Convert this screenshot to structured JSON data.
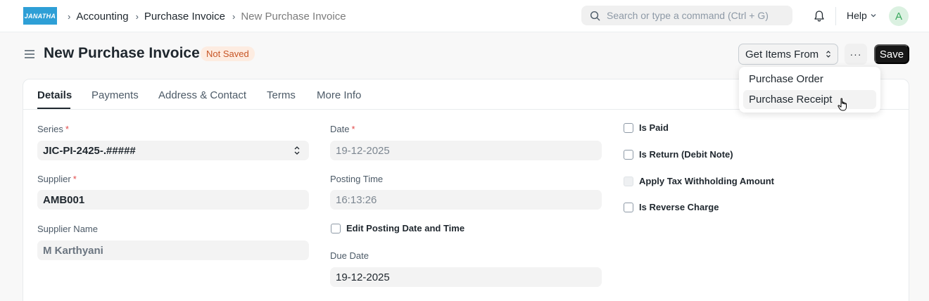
{
  "navbar": {
    "logo_text": "JANATHA",
    "breadcrumbs": [
      "Accounting",
      "Purchase Invoice",
      "New Purchase Invoice"
    ],
    "search_placeholder": "Search or type a command (Ctrl + G)",
    "help_label": "Help",
    "avatar_letter": "A"
  },
  "page": {
    "title": "New Purchase Invoice",
    "status_badge": "Not Saved",
    "get_items_label": "Get Items From",
    "more_label": "···",
    "save_label": "Save"
  },
  "dropdown": {
    "items": [
      "Purchase Order",
      "Purchase Receipt"
    ]
  },
  "tabs": [
    "Details",
    "Payments",
    "Address & Contact",
    "Terms",
    "More Info"
  ],
  "form": {
    "series": {
      "label": "Series",
      "value": "JIC-PI-2425-.#####"
    },
    "supplier": {
      "label": "Supplier",
      "value": "AMB001"
    },
    "supplier_name": {
      "label": "Supplier Name",
      "value": "M Karthyani"
    },
    "date": {
      "label": "Date",
      "value": "19-12-2025"
    },
    "posting_time": {
      "label": "Posting Time",
      "value": "16:13:26"
    },
    "edit_posting": {
      "label": "Edit Posting Date and Time"
    },
    "due_date": {
      "label": "Due Date",
      "value": "19-12-2025"
    },
    "is_paid": {
      "label": "Is Paid"
    },
    "is_return": {
      "label": "Is Return (Debit Note)"
    },
    "apply_tax": {
      "label": "Apply Tax Withholding Amount"
    },
    "reverse_charge": {
      "label": "Is Reverse Charge"
    },
    "required_mark": "*"
  },
  "colors": {
    "accent": "#171717",
    "badge_bg": "#fdece1",
    "badge_text": "#c75525",
    "logo_bg": "#2e9fd6"
  }
}
